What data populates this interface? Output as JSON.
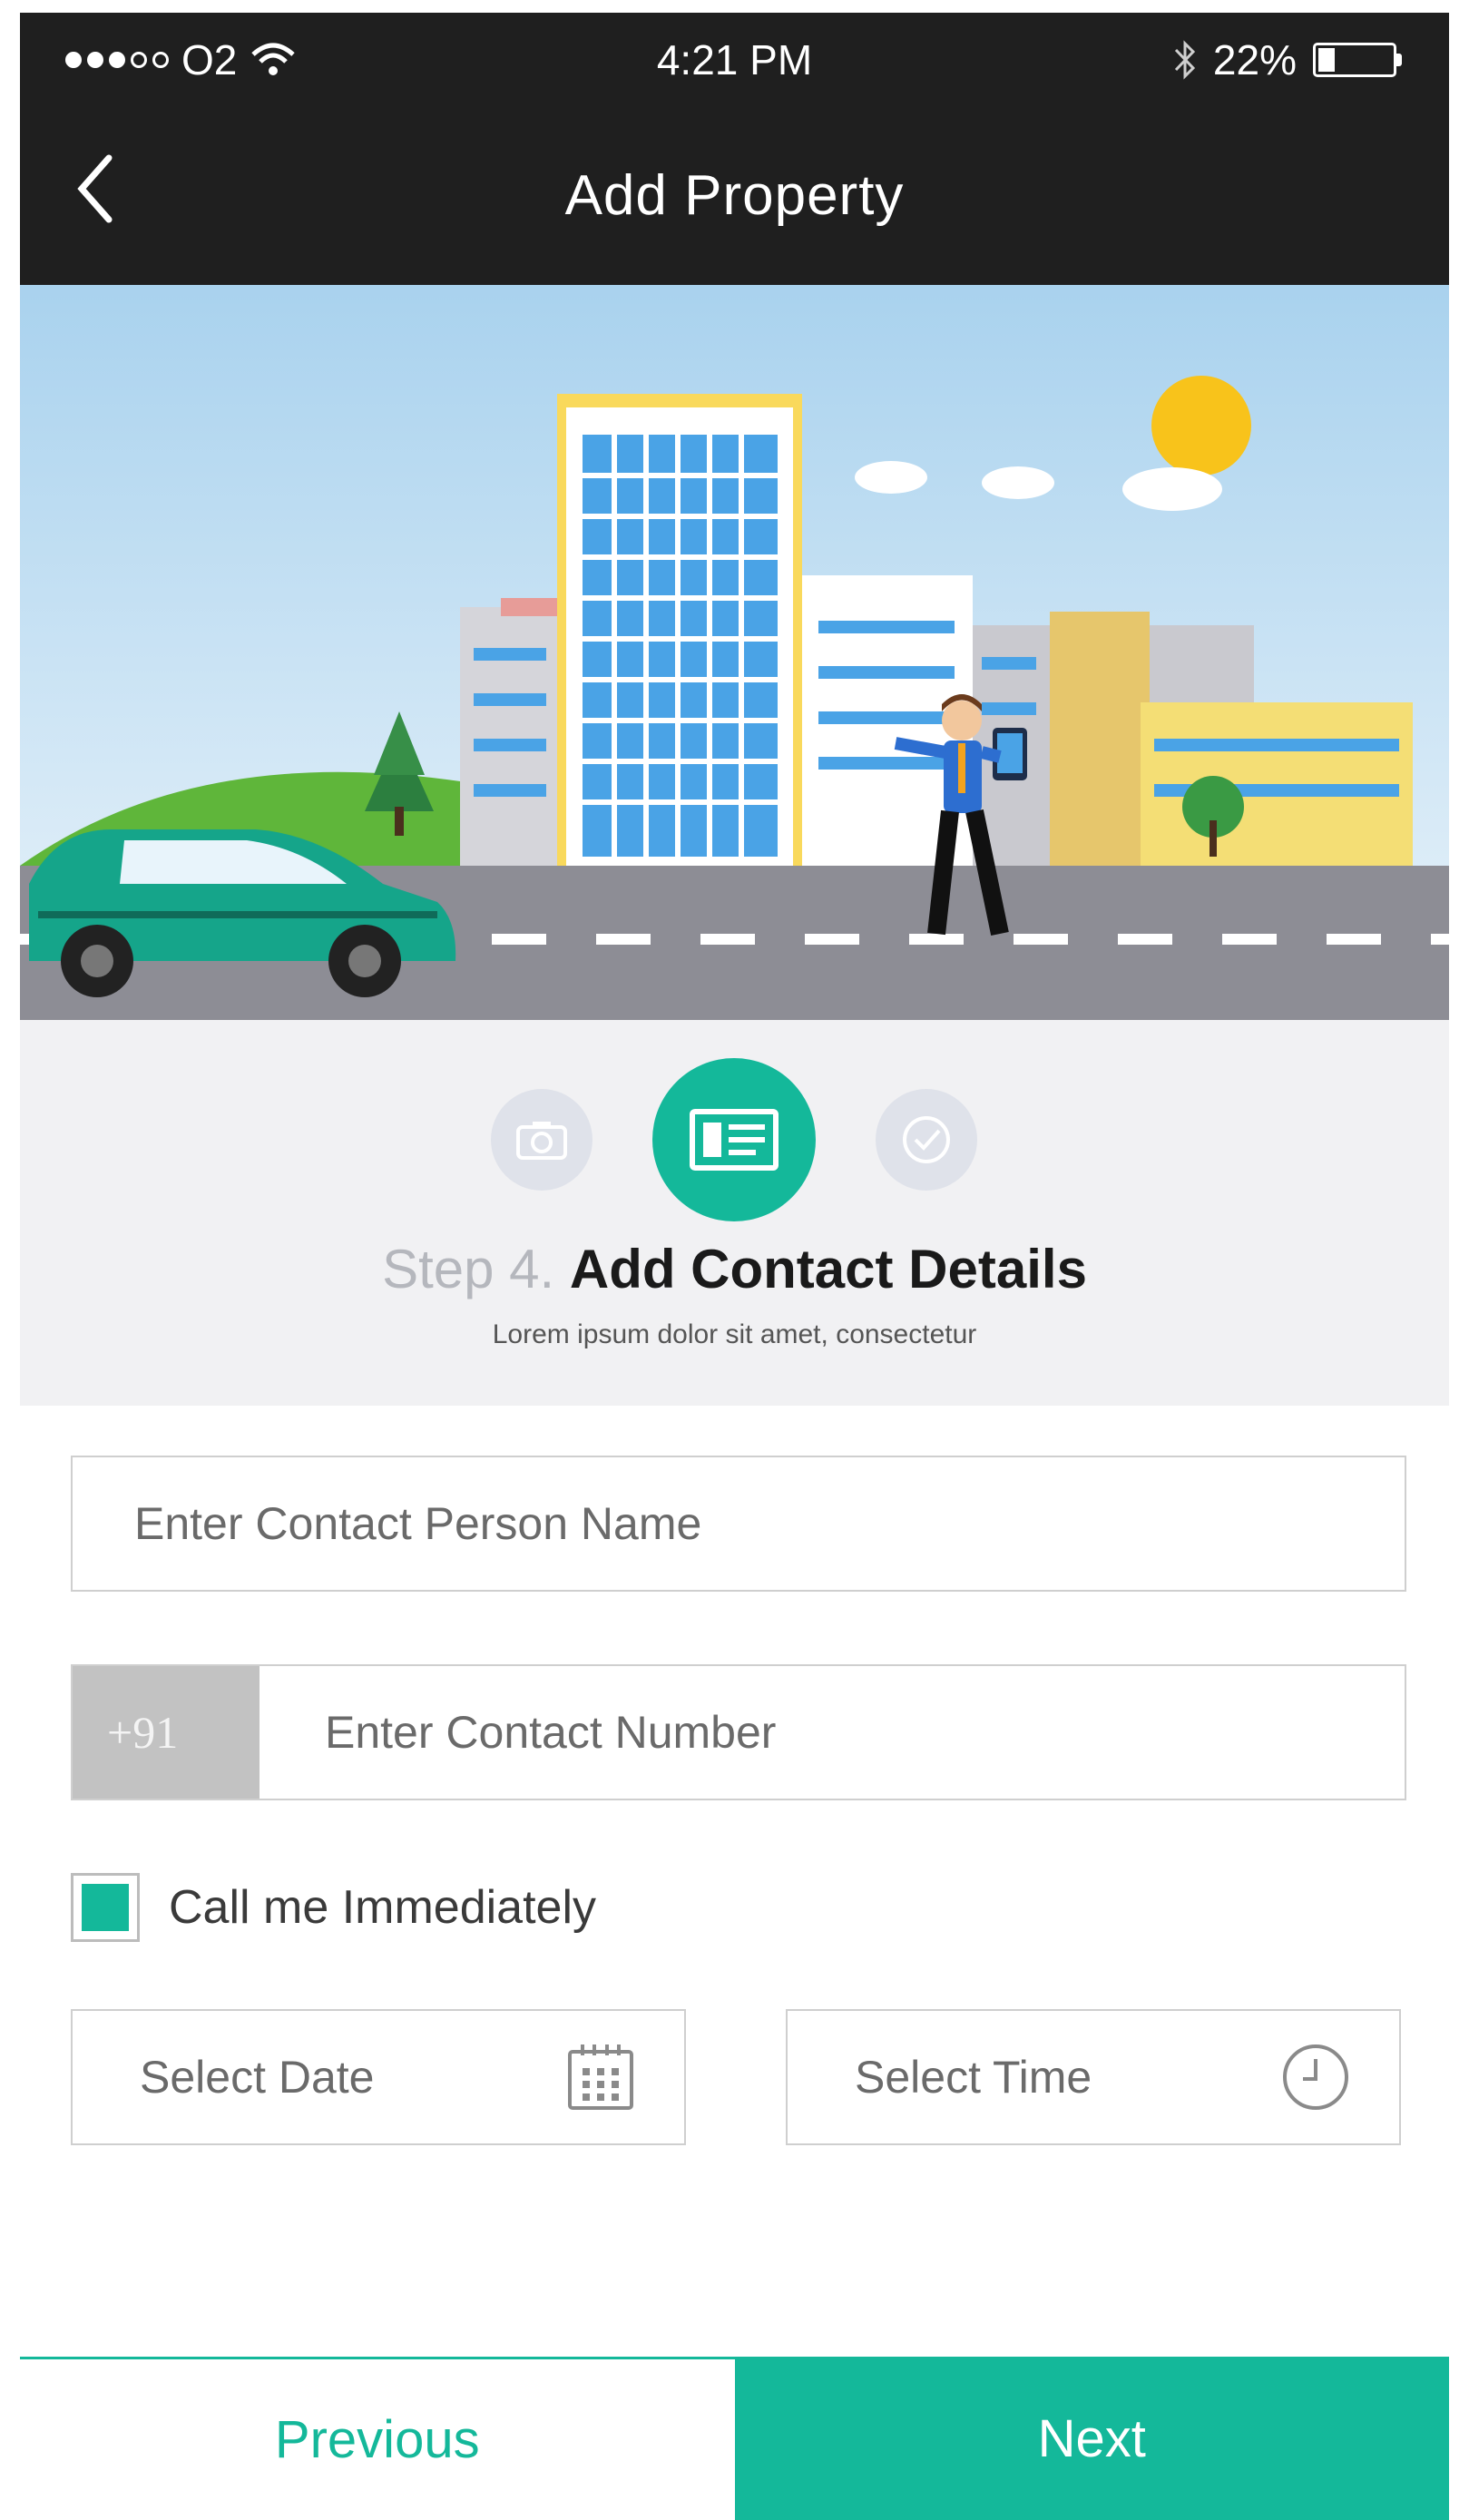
{
  "status_bar": {
    "carrier": "O2",
    "time": "4:21 PM",
    "battery": "22%",
    "battery_level": 0.22,
    "signal_bars_filled": 3,
    "signal_bars_total": 5
  },
  "nav": {
    "title": "Add Property",
    "back_icon": "chevron-left-icon"
  },
  "steps": {
    "icons": [
      "camera-icon",
      "contact-card-icon",
      "check-badge-icon"
    ],
    "active_index": 1,
    "step_number": "Step 4.",
    "step_name": "Add Contact Details",
    "subtitle": "Lorem ipsum dolor sit amet, consectetur"
  },
  "form": {
    "contact_name_placeholder": "Enter Contact Person Name",
    "phone_prefix": "+91",
    "contact_number_placeholder": "Enter Contact Number",
    "call_me_label": "Call me Immediately",
    "call_me_checked": true,
    "date_placeholder": "Select Date",
    "time_placeholder": "Select Time"
  },
  "buttons": {
    "previous": "Previous",
    "next": "Next"
  },
  "colors": {
    "accent": "#14b89a",
    "header": "#1f1f1f",
    "step_bg": "#f1f1f3"
  }
}
